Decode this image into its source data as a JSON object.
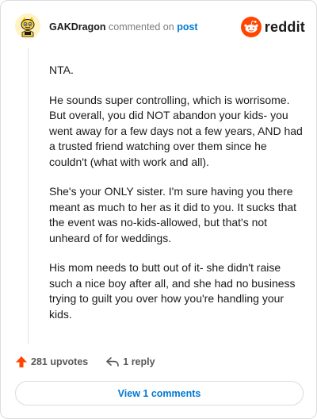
{
  "comment": {
    "author": "GAKDragon",
    "commented_text": "commented on",
    "post_link": "post",
    "paragraphs": [
      "NTA.",
      "He sounds super controlling, which is worrisome. But overall, you did NOT abandon your kids- you went away for a few days not a few years, AND had a trusted friend watching over them since he couldn't (what with work and all).",
      "She's your ONLY sister. I'm sure having you there meant as much to her as it did to you. It sucks that the event was no-kids-allowed, but that's not unheard of for weddings.",
      "His mom needs to butt out of it- she didn't raise such a nice boy after all, and she had no business trying to guilt you over how you're handling your kids."
    ]
  },
  "brand": {
    "name": "reddit",
    "color": "#ff4500"
  },
  "actions": {
    "upvotes": "281 upvotes",
    "replies": "1 reply"
  },
  "footer": {
    "view_comments": "View 1 comments"
  },
  "colors": {
    "link": "#0079d3",
    "upvote": "#ff4500",
    "muted": "#7c7c7c"
  },
  "icons": {
    "avatar": "snoo-avatar-icon",
    "logo": "reddit-logo-icon",
    "upvote": "upvote-arrow-icon",
    "reply": "reply-arrow-icon"
  }
}
